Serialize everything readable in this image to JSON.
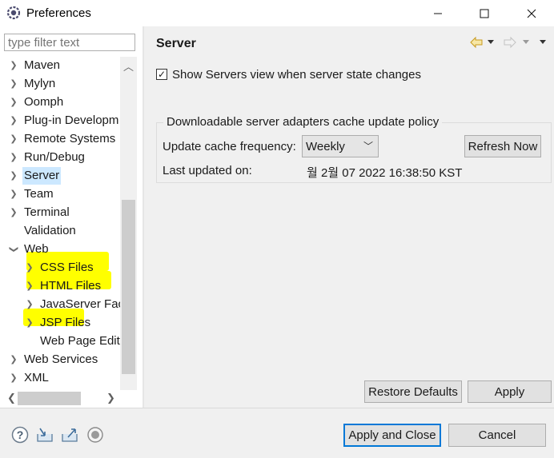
{
  "window": {
    "title": "Preferences",
    "minimize_glyph": "—",
    "maximize_glyph": "☐",
    "close_glyph": "✕"
  },
  "sidebar": {
    "filter_placeholder": "type filter text",
    "items": [
      {
        "label": "Maven",
        "expandable": true
      },
      {
        "label": "Mylyn",
        "expandable": true
      },
      {
        "label": "Oomph",
        "expandable": true
      },
      {
        "label": "Plug-in Developm",
        "expandable": true
      },
      {
        "label": "Remote Systems",
        "expandable": true
      },
      {
        "label": "Run/Debug",
        "expandable": true
      },
      {
        "label": "Server",
        "expandable": true,
        "selected": true
      },
      {
        "label": "Team",
        "expandable": true
      },
      {
        "label": "Terminal",
        "expandable": true
      },
      {
        "label": "Validation",
        "expandable": false
      },
      {
        "label": "Web",
        "expandable": true,
        "expanded": true
      },
      {
        "label": "CSS Files",
        "expandable": true,
        "highlighted": true
      },
      {
        "label": "HTML Files",
        "expandable": true,
        "highlighted": true
      },
      {
        "label": "JavaServer Face",
        "expandable": true
      },
      {
        "label": "JSP Files",
        "expandable": true,
        "highlighted": true
      },
      {
        "label": "Web Page Edit",
        "expandable": false
      },
      {
        "label": "Web Services",
        "expandable": true
      },
      {
        "label": "XML",
        "expandable": true
      }
    ]
  },
  "page": {
    "title": "Server",
    "show_servers_view": {
      "label": "Show Servers view when server state changes",
      "checked": true
    },
    "group": {
      "title": "Downloadable server adapters cache update policy",
      "frequency_label": "Update cache frequency:",
      "frequency_value": "Weekly",
      "refresh_button": "Refresh Now",
      "last_updated_label": "Last updated on:",
      "last_updated_value": "월 2월 07 2022 16:38:50 KST"
    },
    "restore_defaults": "Restore Defaults",
    "apply": "Apply"
  },
  "footer": {
    "apply_and_close": "Apply and Close",
    "cancel": "Cancel",
    "icons": [
      "help-icon",
      "import-icon",
      "export-icon",
      "record-icon"
    ]
  },
  "colors": {
    "selection": "#cce8ff",
    "highlight": "#ffff00",
    "accent": "#0078d7"
  }
}
